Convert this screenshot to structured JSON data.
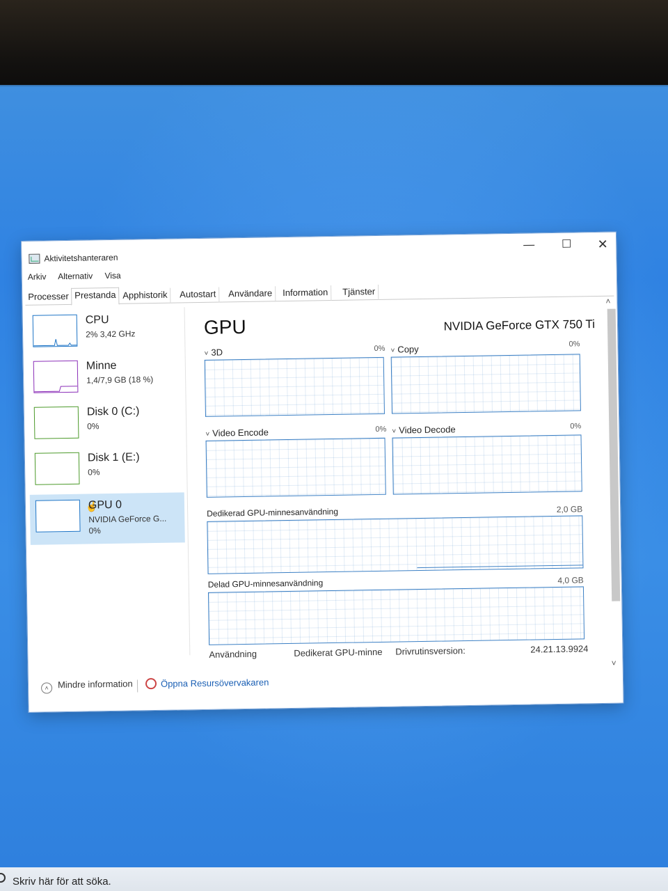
{
  "window": {
    "title": "Aktivitetshanteraren",
    "controls": {
      "minimize": "—",
      "maximize": "☐",
      "close": "✕"
    }
  },
  "menu": [
    "Arkiv",
    "Alternativ",
    "Visa"
  ],
  "tabs": [
    "Processer",
    "Prestanda",
    "Apphistorik",
    "Autostart",
    "Användare",
    "Information",
    "Tjänster"
  ],
  "active_tab": "Prestanda",
  "sidebar": {
    "items": [
      {
        "title": "CPU",
        "sub": "2% 3,42 GHz",
        "sub2": ""
      },
      {
        "title": "Minne",
        "sub": "1,4/7,9 GB (18 %)",
        "sub2": ""
      },
      {
        "title": "Disk 0 (C:)",
        "sub": "0%",
        "sub2": ""
      },
      {
        "title": "Disk 1 (E:)",
        "sub": "0%",
        "sub2": ""
      },
      {
        "title": "GPU 0",
        "sub": "NVIDIA GeForce G...",
        "sub2": "0%"
      }
    ],
    "selected": 4
  },
  "main": {
    "title": "GPU",
    "model": "NVIDIA GeForce GTX 750 Ti",
    "graphs": [
      {
        "label": "3D",
        "value": "0%"
      },
      {
        "label": "Copy",
        "value": "0%"
      },
      {
        "label": "Video Encode",
        "value": "0%"
      },
      {
        "label": "Video Decode",
        "value": "0%"
      }
    ],
    "dedicated_label": "Dedikerad GPU-minnesanvändning",
    "dedicated_max": "2,0 GB",
    "shared_label": "Delad GPU-minnesanvändning",
    "shared_max": "4,0 GB",
    "info": {
      "usage_label": "Användning",
      "dedicated_mem_label": "Dedikerat GPU-minne",
      "driver_label": "Drivrutinsversion:",
      "driver_value": "24.21.13.9924"
    }
  },
  "footer": {
    "less_info": "Mindre information",
    "open_monitor": "Öppna Resursövervakaren"
  },
  "scroll": {
    "up": "˄",
    "down": "˅"
  },
  "chevron": "˅",
  "taskbar": {
    "search_placeholder": "Skriv här för att söka."
  },
  "colors": {
    "accent": "#1d74c6",
    "selected_bg": "#cce4f7",
    "desktop": "#2f82e2"
  }
}
